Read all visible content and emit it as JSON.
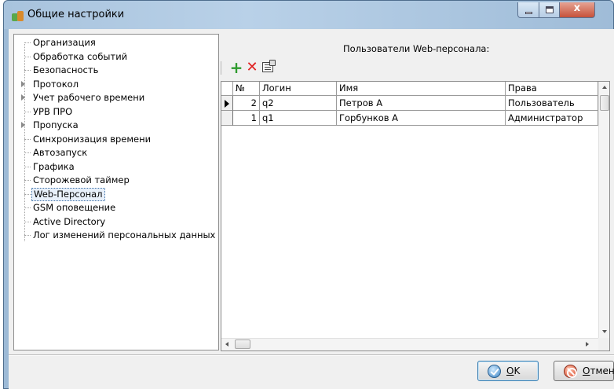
{
  "window": {
    "title": "Общие настройки"
  },
  "tree": {
    "items": [
      {
        "label": "Организация",
        "expandable": false
      },
      {
        "label": "Обработка событий",
        "expandable": false
      },
      {
        "label": "Безопасность",
        "expandable": false
      },
      {
        "label": "Протокол",
        "expandable": true
      },
      {
        "label": "Учет рабочего времени",
        "expandable": true
      },
      {
        "label": "УРВ ПРО",
        "expandable": false
      },
      {
        "label": "Пропуска",
        "expandable": true
      },
      {
        "label": "Синхронизация времени",
        "expandable": false
      },
      {
        "label": "Автозапуск",
        "expandable": false
      },
      {
        "label": "Графика",
        "expandable": false
      },
      {
        "label": "Сторожевой таймер",
        "expandable": false
      },
      {
        "label": "Web-Персонал",
        "expandable": false,
        "selected": true
      },
      {
        "label": "GSM оповещение",
        "expandable": false
      },
      {
        "label": "Active Directory",
        "expandable": false
      },
      {
        "label": "Лог изменений персональных данных",
        "expandable": false
      }
    ]
  },
  "panel": {
    "title": "Пользователи Web-персонала:"
  },
  "toolbar": {
    "add_icon": "+",
    "delete_icon": "✕"
  },
  "grid": {
    "columns": [
      "№",
      "Логин",
      "Имя",
      "Права"
    ],
    "rows": [
      {
        "num": "2",
        "login": "q2",
        "name": "Петров А",
        "rights": "Пользователь",
        "current": true
      },
      {
        "num": "1",
        "login": "q1",
        "name": "Горбунков А",
        "rights": "Администратор",
        "current": false
      }
    ]
  },
  "buttons": {
    "ok_accel": "O",
    "ok_rest": "K",
    "cancel_accel": "О",
    "cancel_rest": "тмена"
  }
}
